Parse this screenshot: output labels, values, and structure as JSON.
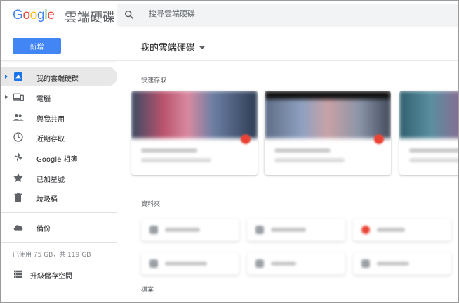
{
  "app": {
    "logo_letters": [
      "G",
      "o",
      "o",
      "g",
      "l",
      "e"
    ],
    "product_name": "雲端硬碟",
    "new_button_label": "新增",
    "drive_title": "我的雲端硬碟"
  },
  "search": {
    "placeholder": "搜尋雲端硬碟"
  },
  "sidebar": {
    "items": [
      {
        "label": "我的雲端硬碟",
        "icon": "drive-icon",
        "active": true,
        "expandable": true
      },
      {
        "label": "電腦",
        "icon": "computer-icon",
        "active": false,
        "expandable": true
      },
      {
        "label": "與我共用",
        "icon": "people-icon",
        "active": false,
        "expandable": false
      },
      {
        "label": "近期存取",
        "icon": "clock-icon",
        "active": false,
        "expandable": false
      },
      {
        "label": "Google 相簿",
        "icon": "photos-pinwheel-icon",
        "active": false,
        "expandable": false
      },
      {
        "label": "已加星號",
        "icon": "star-icon",
        "active": false,
        "expandable": false
      },
      {
        "label": "垃圾桶",
        "icon": "trash-icon",
        "active": false,
        "expandable": false
      }
    ],
    "backup_label": "備份",
    "storage_text": "已使用 75 GB，共 119 GB",
    "upgrade_label": "升級儲存空間"
  },
  "main": {
    "quick_access_label": "快速存取",
    "folders_label": "資料夾",
    "files_label": "檔案"
  },
  "colors": {
    "accent": "#4285f4",
    "active_bg": "#e8e8e8",
    "text": "#202124",
    "muted": "#5f6368"
  }
}
